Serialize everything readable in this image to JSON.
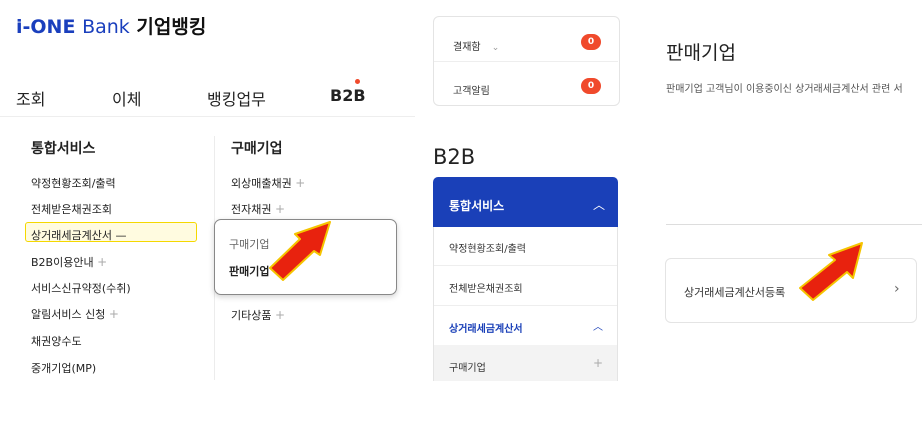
{
  "logo": {
    "prefix": "i-ONE",
    "bank": "Bank",
    "name": "기업뱅킹"
  },
  "topnav": [
    "조회",
    "이체",
    "뱅킹업무",
    "B2B"
  ],
  "menu": {
    "col1": {
      "title": "통합서비스",
      "items": [
        "약정현황조회/출력",
        "전체받은채권조회",
        "상거래세금계산서",
        "B2B이용안내",
        "서비스신규약정(수취)",
        "알림서비스 신청",
        "채권양수도",
        "중개기업(MP)"
      ],
      "highlight_suffix": "—",
      "plus": "+"
    },
    "col2": {
      "title": "구매기업",
      "items": [
        "외상매출채권",
        "전자채권",
        "기타상품"
      ],
      "plus": "+"
    },
    "popup": {
      "items": [
        "구매기업",
        "판매기업"
      ]
    }
  },
  "notifications": [
    {
      "label": "결재함",
      "count": "0",
      "chevron": "⌄"
    },
    {
      "label": "고객알림",
      "count": "0"
    }
  ],
  "side": {
    "title": "B2B",
    "head": "통합서비스",
    "items": [
      "약정현황조회/출력",
      "전체받은채권조회",
      "상거래세금계산서",
      "구매기업"
    ],
    "chev_up": "︿",
    "plus": "+"
  },
  "right": {
    "title": "판매기업",
    "desc": "판매기업 고객님이 이용중이신 상거래세금계산서 관련 서",
    "card_label": "상거래세금계산서등록",
    "card_chevron": "›"
  },
  "colors": {
    "brand": "#1a3fbd",
    "badge": "#f04a2c",
    "highlight": "#f5d800",
    "arrow": "#e8220e"
  }
}
